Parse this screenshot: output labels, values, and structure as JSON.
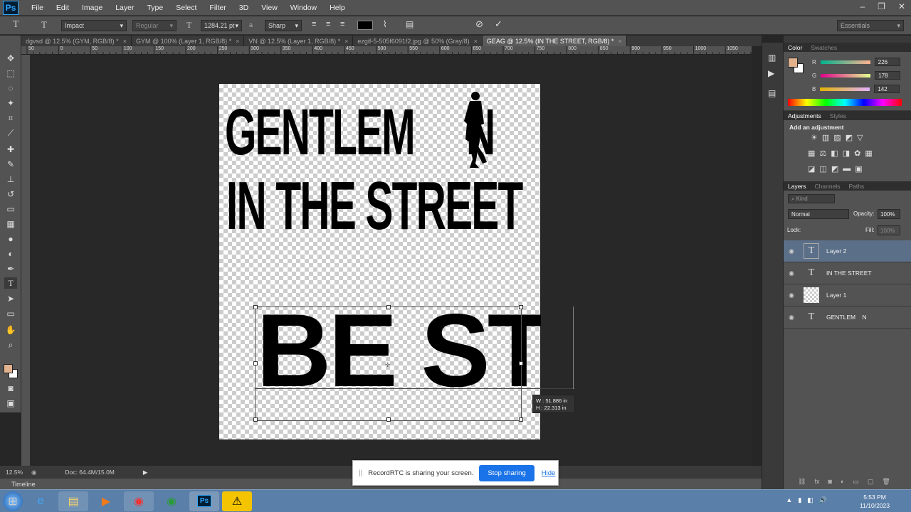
{
  "app": {
    "logo": "Ps",
    "menus": [
      "File",
      "Edit",
      "Image",
      "Layer",
      "Type",
      "Select",
      "Filter",
      "3D",
      "View",
      "Window",
      "Help"
    ],
    "workspace": "Essentials"
  },
  "options": {
    "font_family": "Impact",
    "font_style": "Regular",
    "font_size": "1284.21 pt",
    "aa_label": "a",
    "antialias": "Sharp"
  },
  "tabs": [
    {
      "label": "dgvsd @ 12.5% (GYM, RGB/8) *"
    },
    {
      "label": "GYM @ 100% (Layer 1, RGB/8) *"
    },
    {
      "label": "VN @ 12.5% (Layer 1, RGB/8) *"
    },
    {
      "label": "ezgif-5-505f6091f2.jpg @ 50% (Gray/8)"
    },
    {
      "label": "GEAG @ 12.5% (IN THE STREET, RGB/8) *",
      "active": true
    }
  ],
  "ruler_ticks": [
    "50",
    "0",
    "50",
    "100",
    "150",
    "200",
    "250",
    "300",
    "350",
    "400",
    "450",
    "500",
    "550",
    "600",
    "650",
    "700",
    "750",
    "800",
    "850",
    "900",
    "950",
    "1000",
    "1050"
  ],
  "canvas": {
    "line1": "GENTLEM",
    "line1_end": "N",
    "line2": "IN THE STREET",
    "typing": "BE  ST",
    "dim_w": "W : 51.886 in",
    "dim_h": "H : 22.313 in"
  },
  "status": {
    "zoom": "12.5%",
    "doc": "Doc: 64.4M/15.0M",
    "timeline": "Timeline"
  },
  "share": {
    "message": "RecordRTC is sharing your screen.",
    "stop": "Stop sharing",
    "hide": "Hide"
  },
  "color_panel": {
    "tabs": [
      "Color",
      "Swatches"
    ],
    "r_label": "R",
    "g_label": "G",
    "b_label": "B",
    "r": "226",
    "g": "178",
    "b": "142",
    "fg": "#e2b28e"
  },
  "adjust_panel": {
    "tabs": [
      "Adjustments",
      "Styles"
    ],
    "hint": "Add an adjustment"
  },
  "layers_panel": {
    "tabs": [
      "Layers",
      "Channels",
      "Paths"
    ],
    "kind": "Kind",
    "blend": "Normal",
    "opacity_label": "Opacity:",
    "opacity": "100%",
    "lock_label": "Lock:",
    "fill_label": "Fill:",
    "fill": "100%",
    "layers": [
      {
        "name": "Layer 2",
        "type": "text",
        "selected": true
      },
      {
        "name": "IN THE STREET",
        "type": "text"
      },
      {
        "name": "Layer 1",
        "type": "raster"
      },
      {
        "name": "GENTLEM    N",
        "type": "text"
      }
    ]
  },
  "taskbar": {
    "time": "5:53 PM",
    "date": "11/10/2023"
  }
}
